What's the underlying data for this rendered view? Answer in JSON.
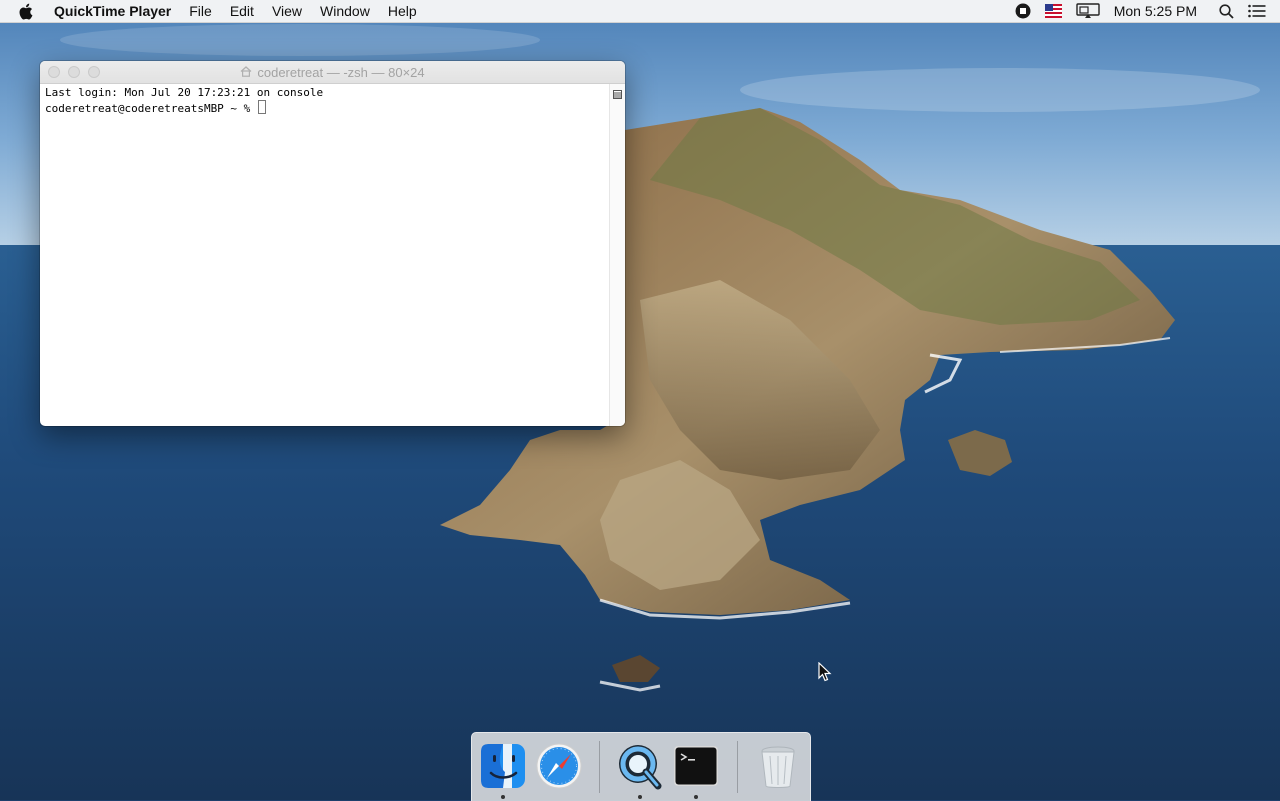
{
  "menubar": {
    "app_name": "QuickTime Player",
    "menus": [
      "File",
      "Edit",
      "View",
      "Window",
      "Help"
    ],
    "clock": "Mon 5:25 PM",
    "status_icons": [
      "screen-recording-stop-icon",
      "us-flag-input-source-icon",
      "airplay-display-icon",
      "spotlight-search-icon",
      "notification-center-icon"
    ]
  },
  "terminal": {
    "title": "coderetreat — -zsh — 80×24",
    "lines": [
      "Last login: Mon Jul 20 17:23:21 on console",
      "coderetreat@coderetreatsMBP ~ % "
    ]
  },
  "dock": {
    "items": [
      "finder-icon",
      "safari-icon",
      "quicktime-icon",
      "terminal-icon",
      "trash-icon"
    ],
    "running": [
      "finder",
      "quicktime",
      "terminal"
    ]
  },
  "colors": {
    "menubar_bg": "#f6f6f6",
    "ocean": "#1d3f6b",
    "sky": "#5f93c4"
  }
}
